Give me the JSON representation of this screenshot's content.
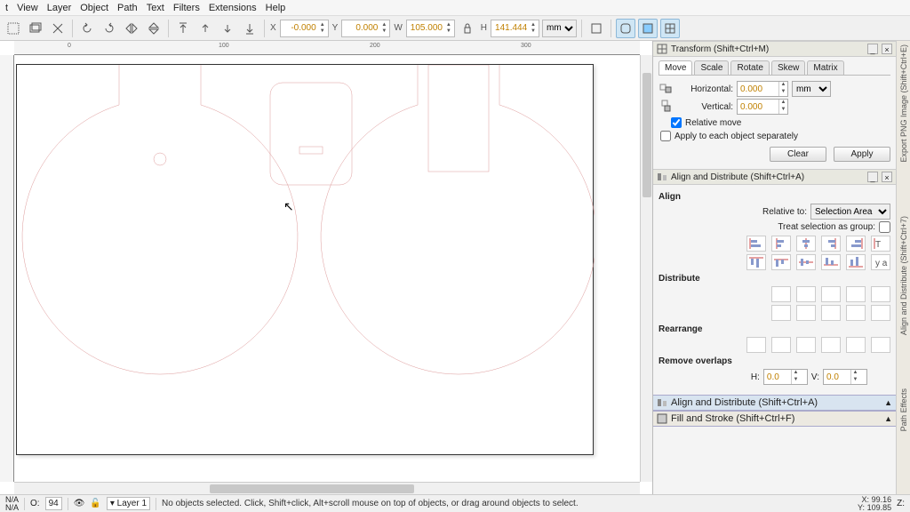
{
  "menubar": {
    "items": [
      "t",
      "View",
      "Layer",
      "Object",
      "Path",
      "Text",
      "Filters",
      "Extensions",
      "Help"
    ]
  },
  "toolbar": {
    "x_label": "X",
    "x": "-0.000",
    "y_label": "Y",
    "y": "0.000",
    "w_label": "W",
    "w": "105.000",
    "h_label": "H",
    "h": "141.444",
    "units": "mm"
  },
  "transform": {
    "title": "Transform (Shift+Ctrl+M)",
    "tabs": [
      "Move",
      "Scale",
      "Rotate",
      "Skew",
      "Matrix"
    ],
    "active_tab": 0,
    "horizontal_label": "Horizontal:",
    "vertical_label": "Vertical:",
    "horizontal": "0.000",
    "vertical": "0.000",
    "units": "mm",
    "relative_move": "Relative move",
    "relative_move_checked": true,
    "apply_each": "Apply to each object separately",
    "apply_each_checked": false,
    "clear": "Clear",
    "apply": "Apply"
  },
  "align": {
    "title": "Align and Distribute (Shift+Ctrl+A)",
    "align_heading": "Align",
    "relative_to_label": "Relative to:",
    "relative_to": "Selection Area",
    "treat_group": "Treat selection as group:",
    "distribute_heading": "Distribute",
    "rearrange_heading": "Rearrange",
    "remove_overlaps_heading": "Remove overlaps",
    "h_label": "H:",
    "v_label": "V:",
    "h_value": "0.0",
    "v_value": "0.0"
  },
  "collapsed_panels": {
    "align": "Align and Distribute (Shift+Ctrl+A)",
    "fill": "Fill and Stroke (Shift+Ctrl+F)"
  },
  "side_tabs": [
    "Export PNG Image (Shift+Ctrl+E)",
    "Align and Distribute (Shift+Ctrl+7)",
    "Path Effects"
  ],
  "status": {
    "na1": "N/A",
    "na2": "N/A",
    "o_label": "O:",
    "opacity": "94",
    "layer": "Layer 1",
    "message": "No objects selected. Click, Shift+click, Alt+scroll mouse on top of objects, or drag around objects to select.",
    "x_label": "X:",
    "x": "99.16",
    "y_label": "Y:",
    "y": "109.85",
    "z_label": "Z:"
  }
}
